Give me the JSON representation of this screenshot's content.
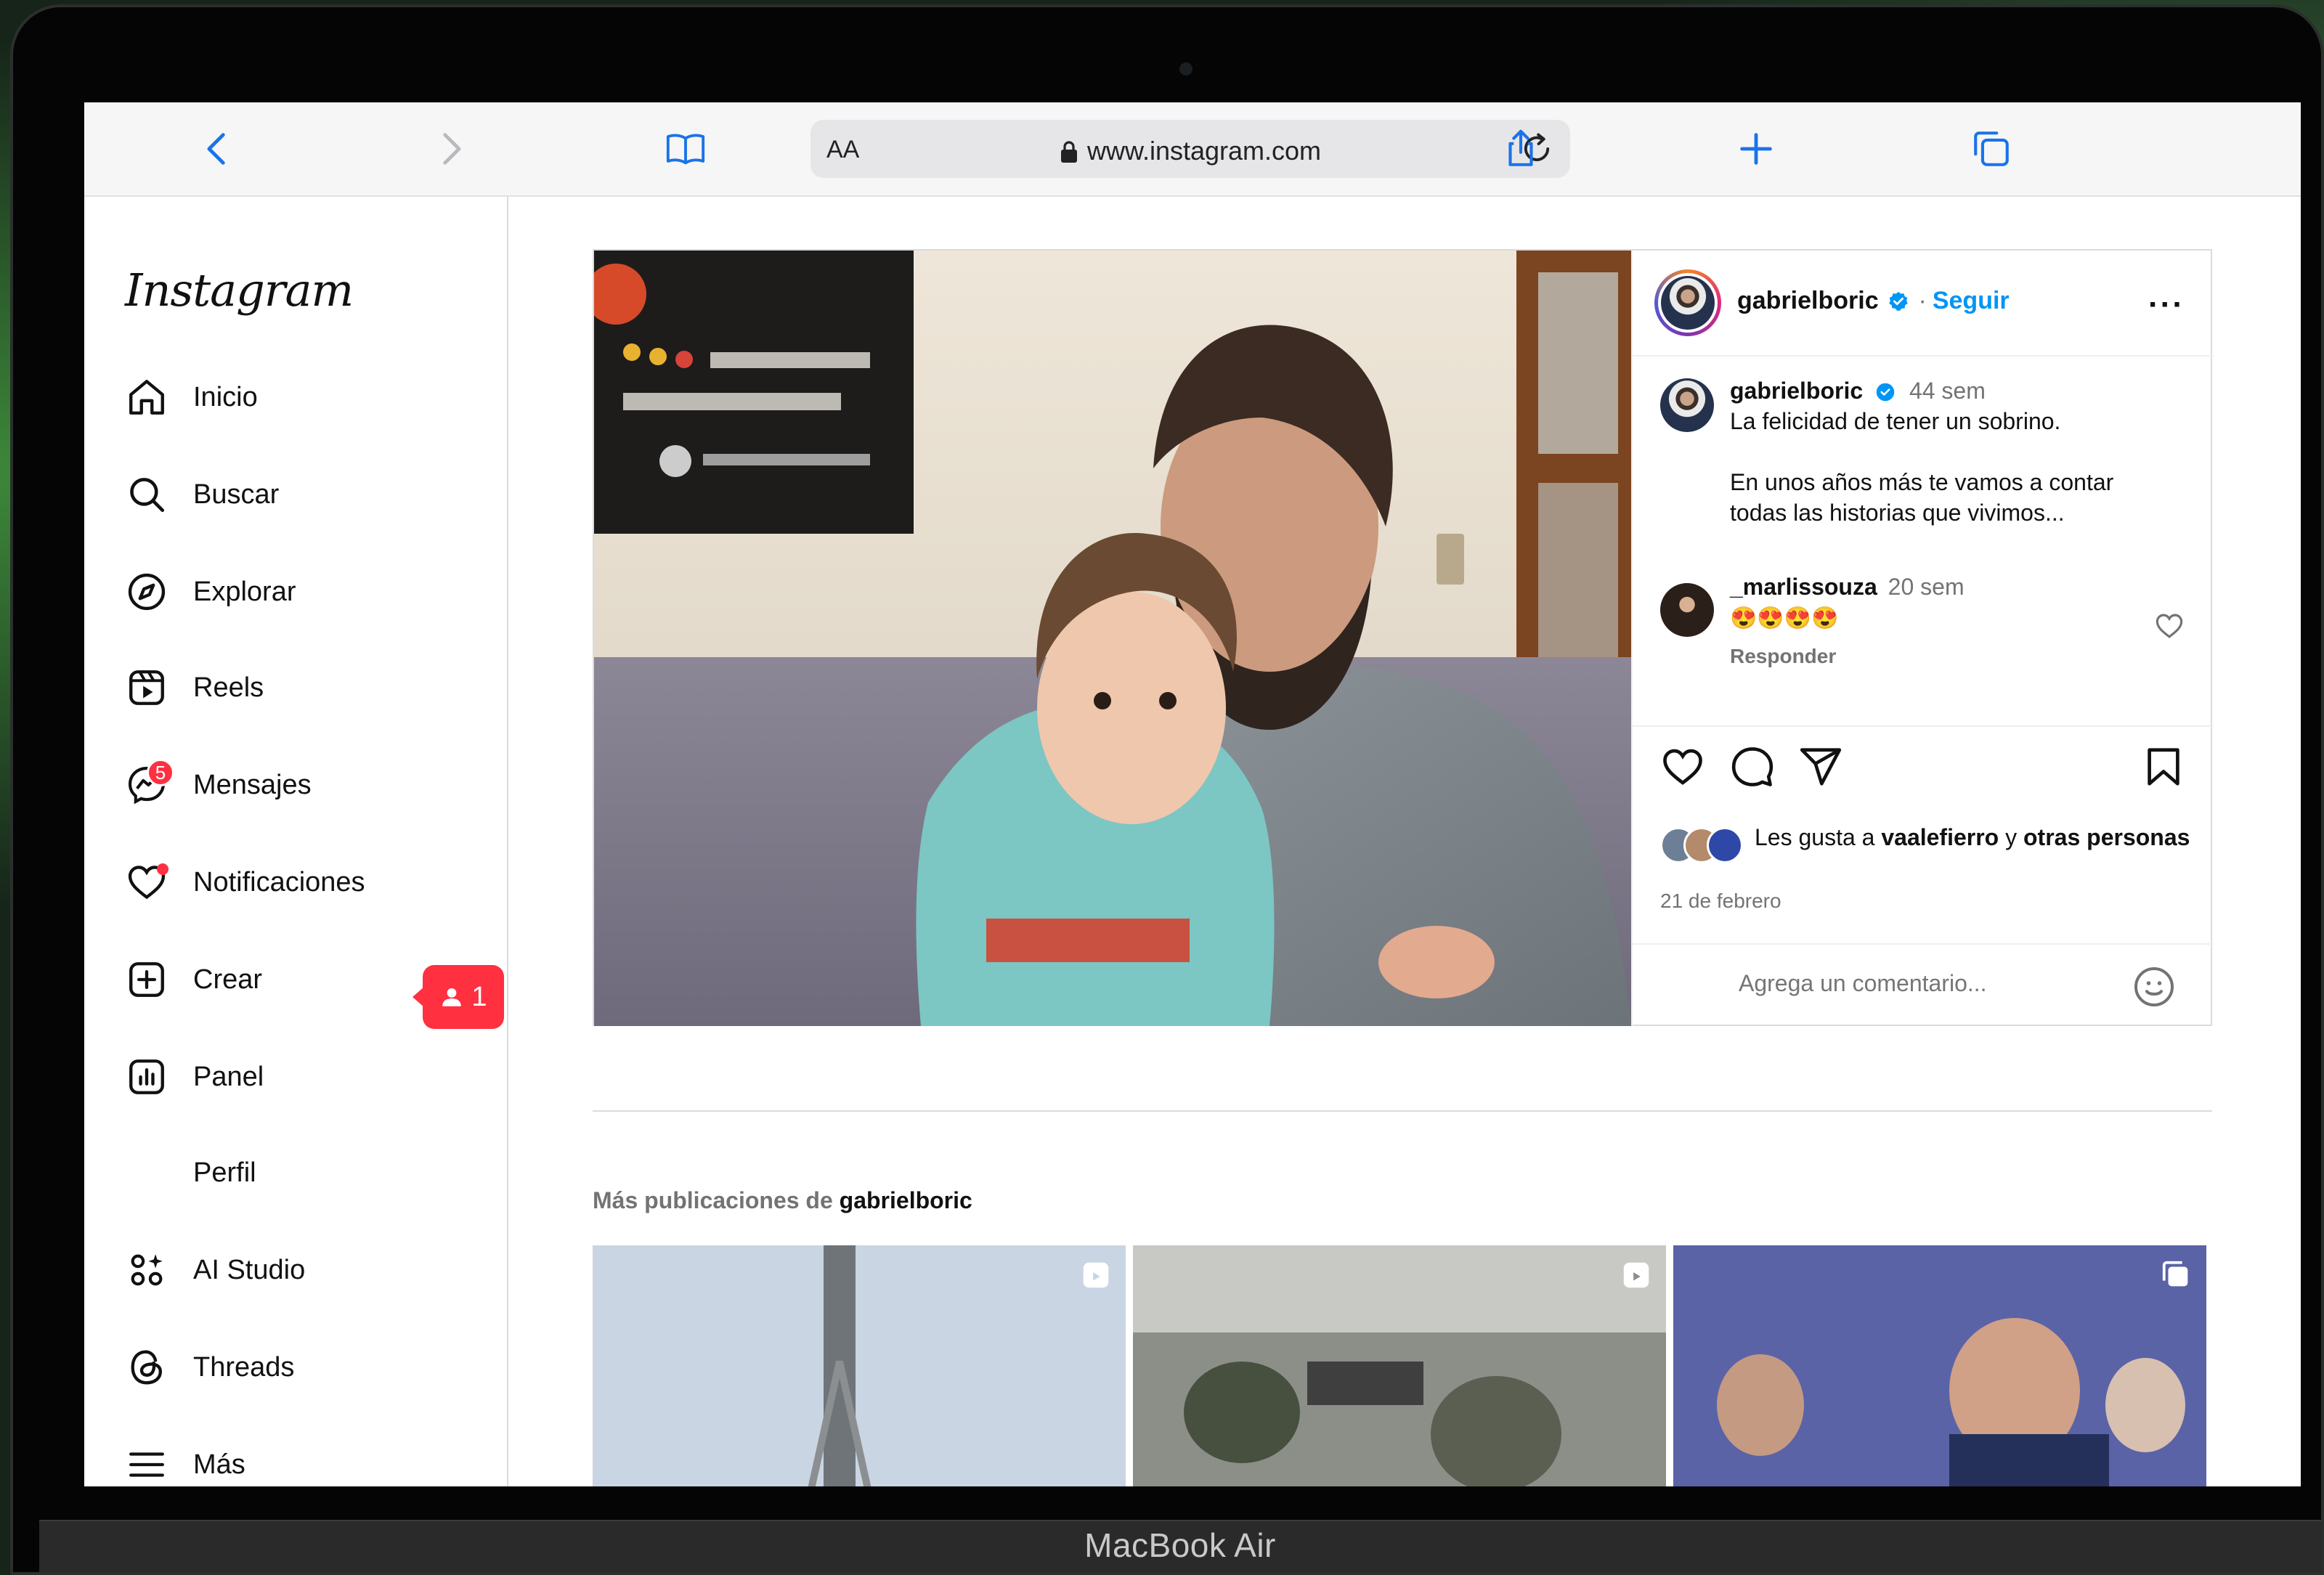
{
  "browser": {
    "url_text_size": "AA",
    "url": "www.instagram.com"
  },
  "sidebar": {
    "logo": "Instagram",
    "items": [
      {
        "label": "Inicio"
      },
      {
        "label": "Buscar"
      },
      {
        "label": "Explorar"
      },
      {
        "label": "Reels"
      },
      {
        "label": "Mensajes",
        "badge": "5"
      },
      {
        "label": "Notificaciones",
        "popup_count": "1"
      },
      {
        "label": "Crear"
      },
      {
        "label": "Panel"
      },
      {
        "label": "Perfil"
      },
      {
        "label": "AI Studio"
      },
      {
        "label": "Threads"
      },
      {
        "label": "Más"
      }
    ]
  },
  "post": {
    "username": "gabrielboric",
    "follow_label": "Seguir",
    "separator": "·",
    "more_label": "···",
    "caption": {
      "username": "gabrielboric",
      "age": "44 sem",
      "line1": "La felicidad de tener un sobrino.",
      "line2": "En unos años más te vamos a contar",
      "line3": "todas las historias que vivimos..."
    },
    "comment": {
      "username": "_marlissouza",
      "age": "20 sem",
      "text": "😍😍😍😍",
      "reply": "Responder"
    },
    "likes": {
      "prefix": "Les gusta a",
      "user": "vaalefierro",
      "mid": "y",
      "suffix": "otras personas"
    },
    "date": "21 de febrero",
    "comment_placeholder": "Agrega un comentario..."
  },
  "more_posts": {
    "prefix": "Más publicaciones de",
    "username": "gabrielboric"
  },
  "device": {
    "label": "MacBook Air"
  },
  "colors": {
    "accent": "#0095f6",
    "badge": "#ff3040"
  }
}
